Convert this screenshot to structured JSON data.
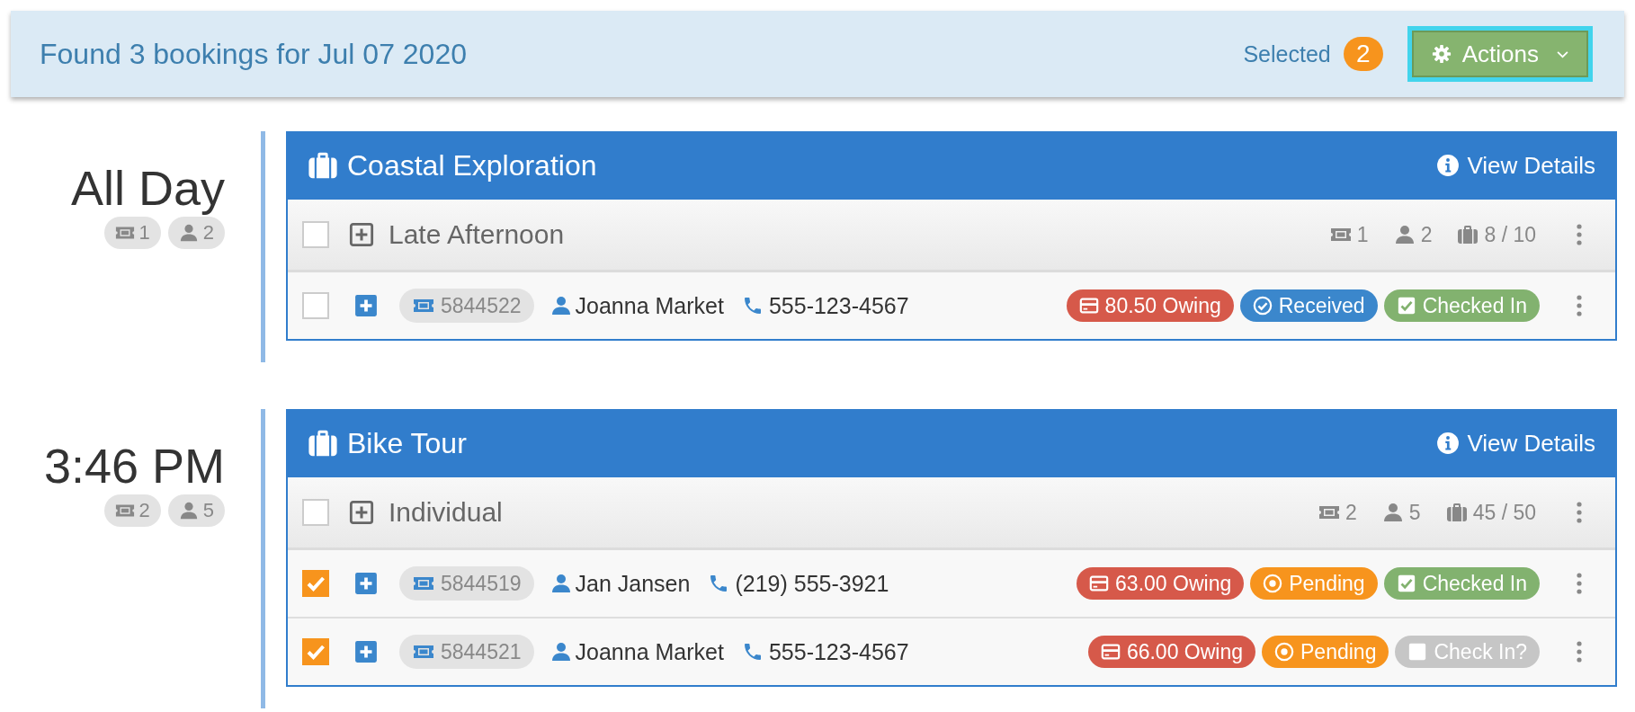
{
  "header": {
    "title": "Found 3 bookings for Jul 07 2020",
    "selected_label": "Selected",
    "selected_count": "2",
    "actions_label": "Actions"
  },
  "groups": [
    {
      "time": "All Day",
      "tickets": "1",
      "guests": "2",
      "product": "Coastal Exploration",
      "view_details": "View Details",
      "session": {
        "name": "Late Afternoon",
        "checked": false,
        "tickets": "1",
        "guests": "2",
        "capacity": "8 / 10"
      },
      "bookings": [
        {
          "checked": false,
          "id": "5844522",
          "name": "Joanna Market",
          "phone": "555-123-4567",
          "owing": "80.50 Owing",
          "payment": {
            "kind": "received",
            "label": "Received"
          },
          "checkin": {
            "checked": true,
            "label": "Checked In"
          }
        }
      ]
    },
    {
      "time": "3:46 PM",
      "tickets": "2",
      "guests": "5",
      "product": "Bike Tour",
      "view_details": "View Details",
      "session": {
        "name": "Individual",
        "checked": false,
        "tickets": "2",
        "guests": "5",
        "capacity": "45 / 50"
      },
      "bookings": [
        {
          "checked": true,
          "id": "5844519",
          "name": "Jan Jansen",
          "phone": "(219) 555-3921",
          "owing": "63.00 Owing",
          "payment": {
            "kind": "pending",
            "label": "Pending"
          },
          "checkin": {
            "checked": true,
            "label": "Checked In"
          }
        },
        {
          "checked": true,
          "id": "5844521",
          "name": "Joanna Market",
          "phone": "555-123-4567",
          "owing": "66.00 Owing",
          "payment": {
            "kind": "pending",
            "label": "Pending"
          },
          "checkin": {
            "checked": false,
            "label": "Check In?"
          }
        }
      ]
    }
  ]
}
